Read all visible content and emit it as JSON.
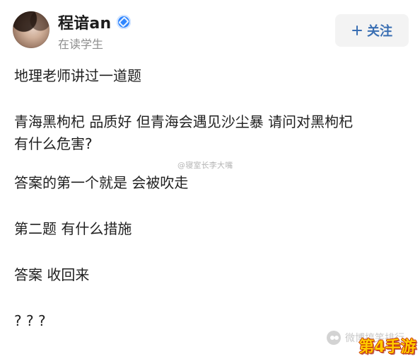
{
  "header": {
    "username": "程谙an",
    "subtitle": "在读学生",
    "follow_label": "关注"
  },
  "post": {
    "paragraphs": [
      "地理老师讲过一道题",
      "青海黑枸杞 品质好 但青海会遇见沙尘暴 请问对黑枸杞\n有什么危害?",
      "答案的第一个就是 会被吹走",
      "第二题 有什么措施",
      "答案 收回来",
      "? ? ?"
    ]
  },
  "watermarks": {
    "center": "@寝室长李大嘴",
    "bottom": "微博搞笑排行"
  },
  "brand": {
    "text": "第4手游"
  },
  "icons": {
    "verified": "verified-badge-icon",
    "follow": "plus-icon",
    "wechat": "wechat-icon"
  },
  "colors": {
    "verified_blue": "#2f86ff",
    "follow_text": "#3a6fb3",
    "subtitle_gray": "#8d8d8d",
    "brand_yellow": "#ffcc00"
  }
}
